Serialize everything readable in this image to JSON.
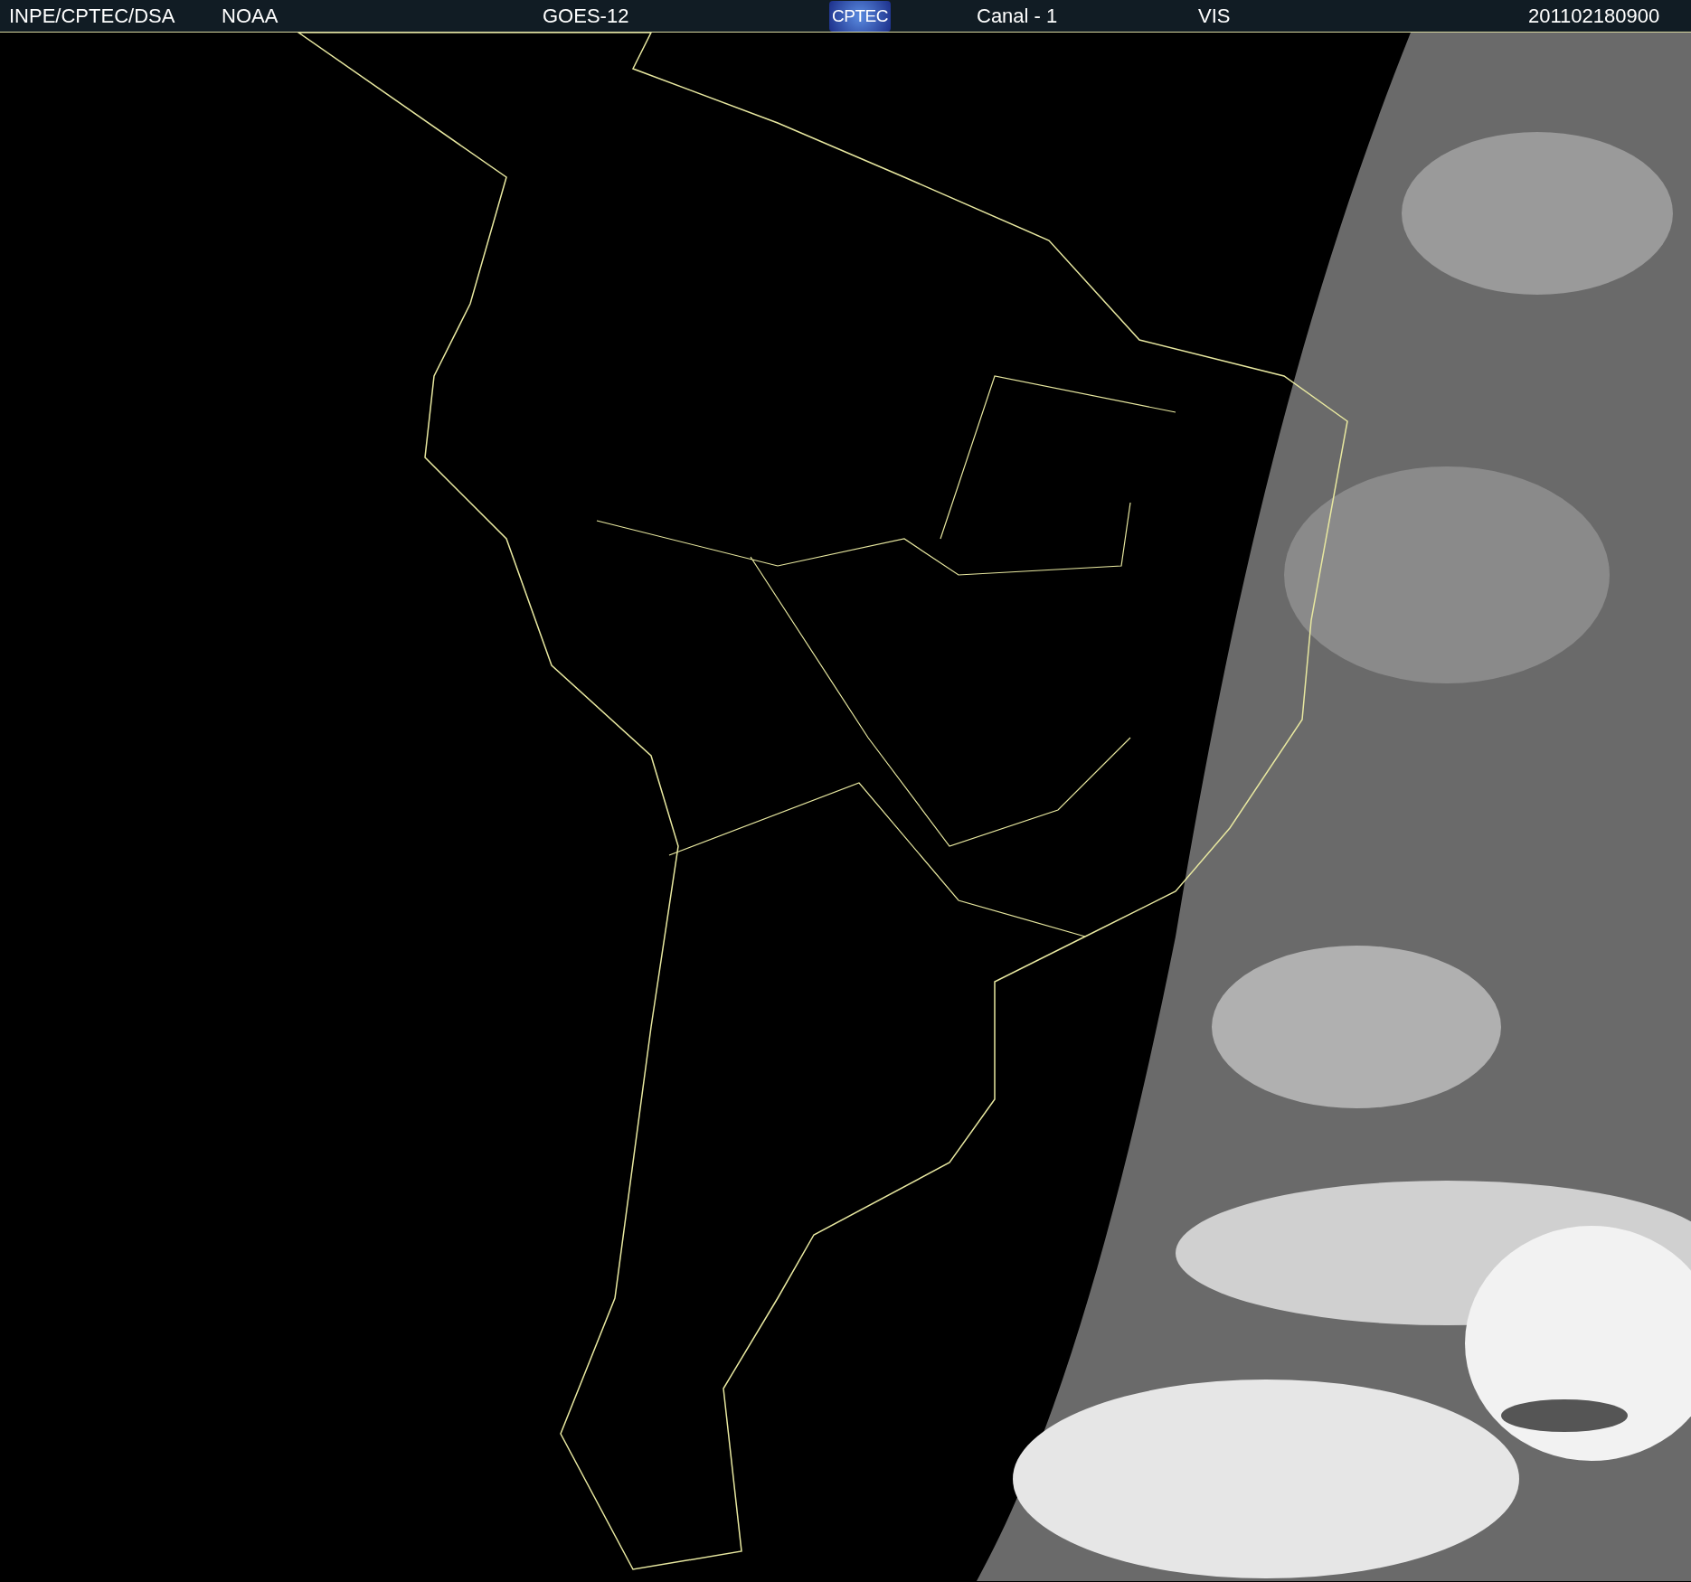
{
  "header": {
    "items": [
      {
        "kind": "text",
        "text": "INPE/CPTEC/DSA"
      },
      {
        "kind": "text",
        "text": "NOAA"
      },
      {
        "kind": "text",
        "text": "GOES-12"
      },
      {
        "kind": "logo",
        "text": "CPTEC"
      },
      {
        "kind": "text",
        "text": "Canal - 1"
      },
      {
        "kind": "text",
        "text": "VIS"
      },
      {
        "kind": "text",
        "text": "201102180900"
      }
    ]
  }
}
